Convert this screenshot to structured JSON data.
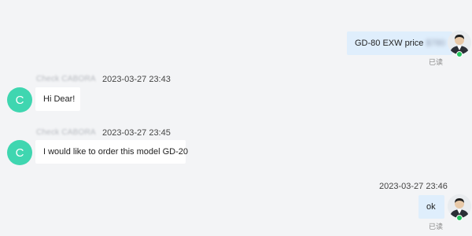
{
  "messages": [
    {
      "direction": "outgoing",
      "text": "GD-80 EXW price",
      "redacted_suffix": "$780",
      "read_status": "已读"
    },
    {
      "direction": "incoming",
      "sender_name": "Check CABORA",
      "avatar_letter": "C",
      "timestamp": "2023-03-27 23:43",
      "text": "Hi Dear!"
    },
    {
      "direction": "incoming",
      "sender_name": "Check CABORA",
      "avatar_letter": "C",
      "timestamp": "2023-03-27 23:45",
      "text": "I would like to order this model GD-20"
    },
    {
      "direction": "outgoing",
      "timestamp": "2023-03-27 23:46",
      "text": "ok",
      "read_status": "已读"
    }
  ],
  "colors": {
    "background": "#f3f4f6",
    "incoming_avatar": "#3fd6b0",
    "outgoing_bubble": "#dfeefc",
    "incoming_bubble": "#ffffff",
    "online_indicator": "#22c55e"
  }
}
